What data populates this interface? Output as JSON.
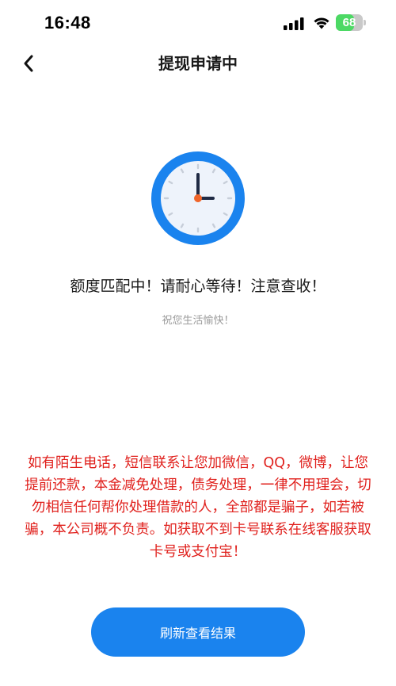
{
  "status_bar": {
    "time": "16:48",
    "battery_level": "68",
    "battery_fraction": 0.68
  },
  "nav": {
    "title": "提现申请中",
    "back_icon": "chevron-left-icon"
  },
  "clock": {
    "icon": "clock-icon",
    "ring_color": "#1a83ee",
    "face_color": "#eef3fb",
    "hand_color": "#1f2a44",
    "center_color": "#f0652a"
  },
  "message": {
    "headline": "额度匹配中！请耐心等待！注意查收！",
    "subline": "祝您生活愉快！"
  },
  "warning": {
    "text": "如有陌生电话，短信联系让您加微信，QQ，微博，让您提前还款，本金减免处理，债务处理，一律不用理会，切勿相信任何帮你处理借款的人，全部都是骗子，如若被骗，本公司概不负责。如获取不到卡号联系在线客服获取卡号或支付宝！",
    "color": "#e0211d"
  },
  "actions": {
    "refresh_label": "刷新查看结果",
    "button_color": "#1a83ee"
  }
}
